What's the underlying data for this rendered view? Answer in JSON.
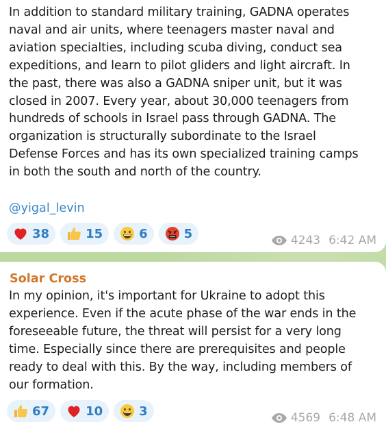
{
  "messages": [
    {
      "text": "In addition to standard military training, GADNA operates\nnaval and air units, where teenagers master naval and\naviation specialties, including scuba diving, conduct sea\nexpeditions, and learn to pilot gliders and light aircraft. In\nthe past, there was also a GADNA sniper unit, but it was\nclosed in 2007. Every year, about 30,000 teenagers from\nhundreds of schools in Israel pass through GADNA. The\norganization is structurally subordinate to the Israel\nDefense Forces and has its own specialized training camps\nin both the south and north of the country.",
      "mention": "@yigal_levin",
      "reactions": [
        {
          "emoji": "red-heart",
          "count": "38"
        },
        {
          "emoji": "thumbs-up",
          "count": "15"
        },
        {
          "emoji": "grinning-face",
          "count": "6"
        },
        {
          "emoji": "angry-cursing-face",
          "count": "5"
        }
      ],
      "views": "4243",
      "time": "6:42 AM"
    },
    {
      "sender": "Solar Cross",
      "text": "In my opinion, it's important for Ukraine to adopt this\nexperience. Even if the acute phase of the war ends in the\nforeseeable future, the threat will persist for a very long\ntime. Especially since there are prerequisites and people\nready to deal with this. By the way, including members of\nour formation.",
      "reactions": [
        {
          "emoji": "thumbs-up",
          "count": "67"
        },
        {
          "emoji": "red-heart",
          "count": "10"
        },
        {
          "emoji": "grinning-face",
          "count": "3"
        }
      ],
      "views": "4569",
      "time": "6:48 AM"
    }
  ],
  "colors": {
    "sender_name": "#d0782b",
    "mention_link": "#3a88c8",
    "reaction_bg": "#e8f2fb",
    "reaction_count": "#2f7ec3",
    "meta_text": "#a8a8a8"
  }
}
